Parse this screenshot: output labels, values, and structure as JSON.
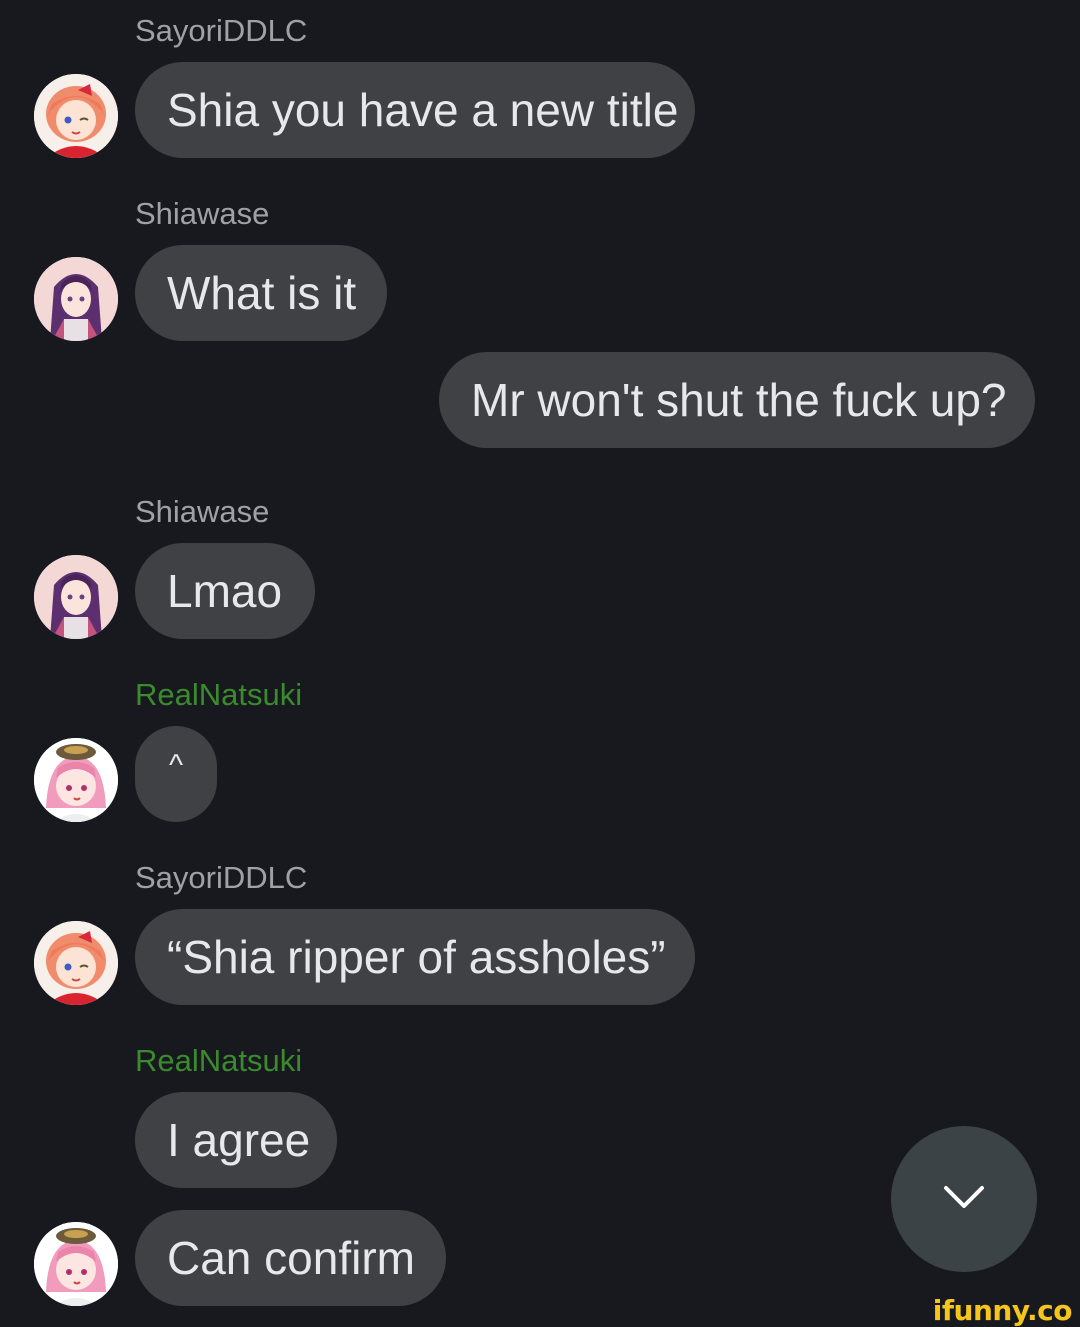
{
  "messages": [
    {
      "sender": "SayoriDDLC",
      "text": "Shia you have a new title"
    },
    {
      "sender": "Shiawase",
      "text": "What is it"
    },
    {
      "text": "Mr won't shut the fuck up?"
    },
    {
      "sender": "Shiawase",
      "text": "Lmao"
    },
    {
      "sender": "RealNatsuki",
      "text": "^"
    },
    {
      "sender": "SayoriDDLC",
      "text": "“Shia ripper of assholes”"
    },
    {
      "sender": "RealNatsuki",
      "text": "I agree"
    },
    {
      "text": "Can confirm"
    }
  ],
  "colors": {
    "background": "#17191e",
    "bubble": "#3f4145",
    "sender_name": "#9ea1a6",
    "sender_name_highlight": "#3a8a2e",
    "scroll_button": "#3b4347"
  },
  "icons": {
    "scroll_down": "chevron-down-icon"
  },
  "watermark": {
    "text": "ifunny.co"
  }
}
